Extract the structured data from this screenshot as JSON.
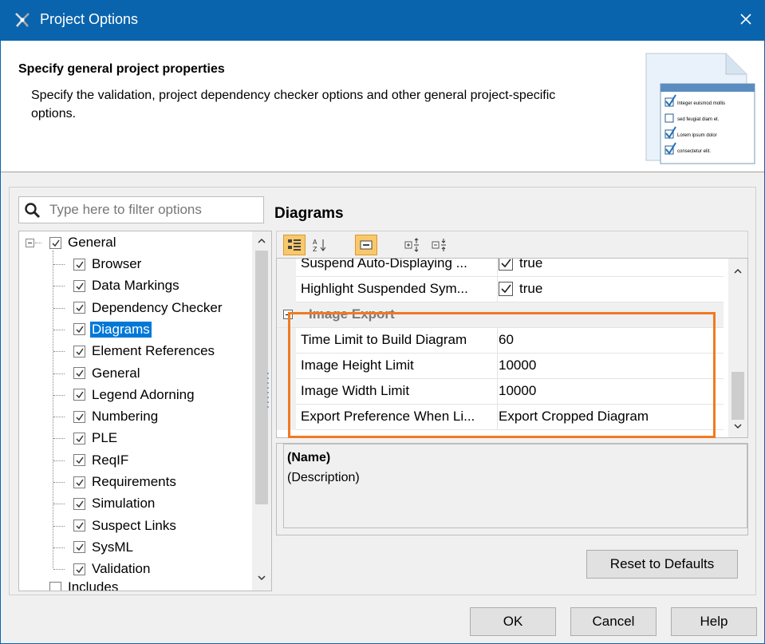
{
  "window": {
    "title": "Project Options",
    "app_icon": "magicdraw-logo-icon",
    "close_icon": "close-icon"
  },
  "header": {
    "title": "Specify general project properties",
    "description": "Specify the validation, project dependency checker options and other general project-specific options.",
    "graphic": {
      "icon": "checklist-document-icon",
      "items": [
        {
          "label": "Integer euismod mollis",
          "checked": true
        },
        {
          "label": "sed feugiat diam et.",
          "checked": false
        },
        {
          "label": "Lorem ipsum dolor",
          "checked": true
        },
        {
          "label": "consectetur elit.",
          "checked": true
        }
      ]
    }
  },
  "filter": {
    "placeholder": "Type here to filter options",
    "value": ""
  },
  "tree": {
    "root": {
      "label": "General",
      "checked": true,
      "expanded": true
    },
    "items": [
      {
        "label": "Browser",
        "checked": true,
        "selected": false
      },
      {
        "label": "Data Markings",
        "checked": true,
        "selected": false
      },
      {
        "label": "Dependency Checker",
        "checked": true,
        "selected": false
      },
      {
        "label": "Diagrams",
        "checked": true,
        "selected": true
      },
      {
        "label": "Element References",
        "checked": true,
        "selected": false
      },
      {
        "label": "General",
        "checked": true,
        "selected": false
      },
      {
        "label": "Legend Adorning",
        "checked": true,
        "selected": false
      },
      {
        "label": "Numbering",
        "checked": true,
        "selected": false
      },
      {
        "label": "PLE",
        "checked": true,
        "selected": false
      },
      {
        "label": "ReqIF",
        "checked": true,
        "selected": false
      },
      {
        "label": "Requirements",
        "checked": true,
        "selected": false
      },
      {
        "label": "Simulation",
        "checked": true,
        "selected": false
      },
      {
        "label": "Suspect Links",
        "checked": true,
        "selected": false
      },
      {
        "label": "SysML",
        "checked": true,
        "selected": false
      },
      {
        "label": "Validation",
        "checked": true,
        "selected": false
      }
    ],
    "next_partial_label": "Includes"
  },
  "panel": {
    "title": "Diagrams",
    "toolbar": [
      {
        "icon": "categorized-view-icon",
        "active": true
      },
      {
        "icon": "sort-alphabetical-icon",
        "active": false
      },
      {
        "icon": "show-description-icon",
        "active": true
      },
      {
        "icon": "expand-all-icon",
        "active": false
      },
      {
        "icon": "collapse-all-icon",
        "active": false
      }
    ],
    "properties": [
      {
        "name": "Suspend Auto-Displaying ...",
        "value": "true",
        "type": "checkbox"
      },
      {
        "name": "Highlight Suspended Sym...",
        "value": "true",
        "type": "checkbox"
      }
    ],
    "group": {
      "name": "Image Export",
      "rows": [
        {
          "name": "Time Limit to Build Diagram",
          "value": "60"
        },
        {
          "name": "Image Height Limit",
          "value": "10000"
        },
        {
          "name": "Image Width Limit",
          "value": "10000"
        },
        {
          "name": "Export Preference When Li...",
          "value": "Export Cropped Diagram"
        }
      ]
    },
    "description": {
      "name": "(Name)",
      "text": "(Description)"
    },
    "highlight_color": "#f07a21"
  },
  "buttons": {
    "reset": "Reset to Defaults",
    "ok": "OK",
    "cancel": "Cancel",
    "help": "Help"
  },
  "colors": {
    "titlebar": "#0a64ad",
    "selection": "#0078d7",
    "toolbar_active": "#f9c86a"
  }
}
